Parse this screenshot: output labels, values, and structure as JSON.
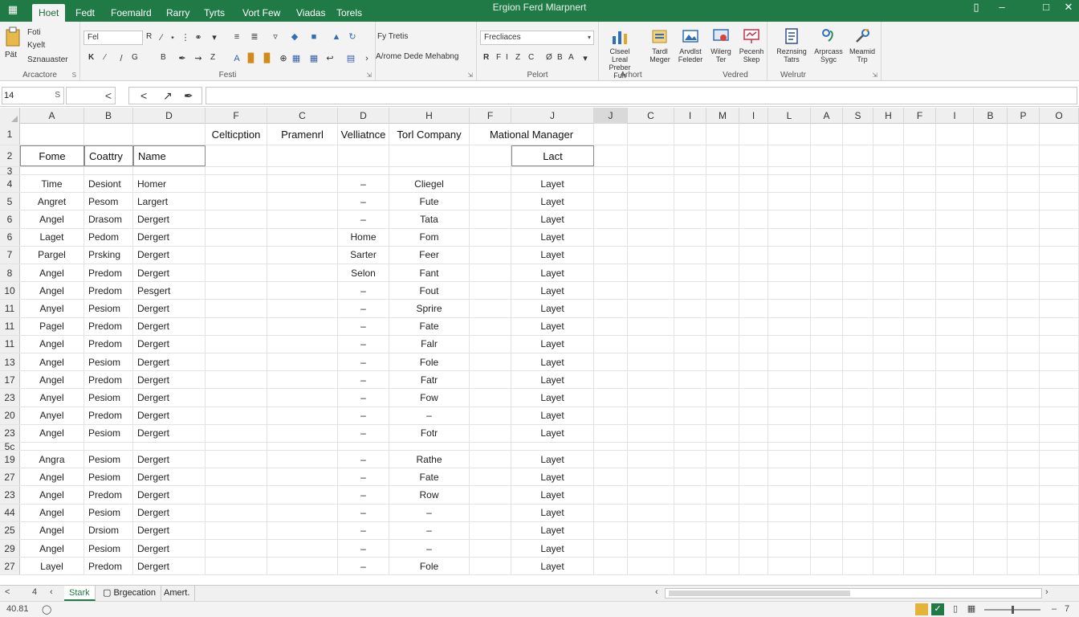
{
  "window": {
    "title": "Ergion Ferd Mlarpnert",
    "app_icon": "grid-icon",
    "tabs": [
      "Hoet",
      "Fedt",
      "Foemalrd",
      "Rarry",
      "Tyrts",
      "Vort Few",
      "Viadas",
      "Torels"
    ],
    "controls": [
      "▯",
      "–",
      "□",
      "✕"
    ]
  },
  "ribbon": {
    "clipboard": {
      "label": "Arcactore",
      "lines": [
        "Foti",
        "Kyelt",
        "Sznauaster"
      ],
      "paste_label": "Pät"
    },
    "font": {
      "label": "Festi",
      "font_name": "Fel",
      "size": "R",
      "row2": [
        "K",
        "⁄",
        "G",
        "B",
        "Z",
        "K"
      ]
    },
    "alignment": {
      "top_label": "Fy Tretis",
      "bottom_label": "A/rome Dede Mehabng"
    },
    "number": {
      "label": "Pelort",
      "format": "Frecliaces",
      "row2": [
        "R",
        "F",
        "I",
        "Z",
        "C",
        "Ø",
        "B",
        "A"
      ]
    },
    "styles": {
      "label": "Arhort",
      "buttons": [
        "Clseel Lreal\nPreber Fuh",
        "Tardl\nMeger",
        "Arvdlst\nFeleder",
        "Wilerg\nTer",
        "Pecenh\nSkep"
      ]
    },
    "editing": {
      "label": "Vedred",
      "buttons": [
        "Reznsing\nTatrs",
        "Arprcass\nSygc",
        "Meamid\nTrp"
      ]
    },
    "extra_label": "Welrutr"
  },
  "formula_bar": {
    "name_box": "14",
    "name_box_arrow": "S",
    "collapse": "<",
    "cancel": "<",
    "confirm": "↗",
    "fx": "✒",
    "value": ""
  },
  "grid": {
    "columns": [
      "A",
      "B",
      "D",
      "F",
      "C",
      "D",
      "H",
      "F",
      "J",
      "J",
      "C",
      "I",
      "M",
      "I",
      "L",
      "A",
      "S",
      "H",
      "F",
      "I",
      "B",
      "P",
      "O"
    ],
    "header_row": {
      "num": "1",
      "cells": [
        "",
        "",
        "",
        "Celticption",
        "Pramenrl",
        "Velliatnce",
        "Torl Company",
        "Mational Manager"
      ]
    },
    "label_row": {
      "num": "2",
      "cells": [
        "Fome",
        "Coattry",
        "Name",
        "",
        "",
        "",
        "",
        "",
        "Lact"
      ]
    },
    "blank_row": {
      "num": "3"
    },
    "rows": [
      {
        "num": "4",
        "a": "Time",
        "b": "Desiont",
        "c": "Homer",
        "f": "–",
        "h": "Cliegel",
        "j": "Layet"
      },
      {
        "num": "5",
        "a": "Angret",
        "b": "Pesom",
        "c": "Largert",
        "f": "–",
        "h": "Fute",
        "j": "Layet"
      },
      {
        "num": "6",
        "a": "Angel",
        "b": "Drasom",
        "c": "Dergert",
        "f": "–",
        "h": "Tata",
        "j": "Layet"
      },
      {
        "num": "6",
        "a": "Laget",
        "b": "Pedom",
        "c": "Dergert",
        "f": "Home",
        "h": "Fom",
        "j": "Layet"
      },
      {
        "num": "7",
        "a": "Pargel",
        "b": "Prsking",
        "c": "Dergert",
        "f": "Sarter",
        "h": "Feer",
        "j": "Layet"
      },
      {
        "num": "8",
        "a": "Angel",
        "b": "Predom",
        "c": "Dergert",
        "f": "Selon",
        "h": "Fant",
        "j": "Layet"
      },
      {
        "num": "10",
        "a": "Angel",
        "b": "Predom",
        "c": "Pesgert",
        "f": "–",
        "h": "Fout",
        "j": "Layet"
      },
      {
        "num": "11",
        "a": "Anyel",
        "b": "Pesiom",
        "c": "Dergert",
        "f": "–",
        "h": "Sprire",
        "j": "Layet"
      },
      {
        "num": "11",
        "a": "Pagel",
        "b": "Predom",
        "c": "Dergert",
        "f": "–",
        "h": "Fate",
        "j": "Layet"
      },
      {
        "num": "11",
        "a": "Angel",
        "b": "Predom",
        "c": "Dergert",
        "f": "–",
        "h": "Falr",
        "j": "Layet"
      },
      {
        "num": "13",
        "a": "Angel",
        "b": "Pesiom",
        "c": "Dergert",
        "f": "–",
        "h": "Fole",
        "j": "Layet"
      },
      {
        "num": "17",
        "a": "Angel",
        "b": "Predom",
        "c": "Dergert",
        "f": "–",
        "h": "Fatr",
        "j": "Layet"
      },
      {
        "num": "23",
        "a": "Anyel",
        "b": "Pesiom",
        "c": "Dergert",
        "f": "–",
        "h": "Fow",
        "j": "Layet"
      },
      {
        "num": "20",
        "a": "Anyel",
        "b": "Predom",
        "c": "Dergert",
        "f": "–",
        "h": "–",
        "j": "Layet"
      },
      {
        "num": "23",
        "a": "Angel",
        "b": "Pesiom",
        "c": "Dergert",
        "f": "–",
        "h": "Fotr",
        "j": "Layet"
      },
      {
        "num": "5c",
        "a": "",
        "b": "",
        "c": "",
        "f": "",
        "h": "",
        "j": ""
      },
      {
        "num": "19",
        "a": "Angra",
        "b": "Pesiom",
        "c": "Dergert",
        "f": "–",
        "h": "Rathe",
        "j": "Layet"
      },
      {
        "num": "27",
        "a": "Angel",
        "b": "Pesiom",
        "c": "Dergert",
        "f": "–",
        "h": "Fate",
        "j": "Layet"
      },
      {
        "num": "23",
        "a": "Angel",
        "b": "Predom",
        "c": "Dergert",
        "f": "–",
        "h": "Row",
        "j": "Layet"
      },
      {
        "num": "44",
        "a": "Angel",
        "b": "Pesiom",
        "c": "Dergert",
        "f": "–",
        "h": "–",
        "j": "Layet"
      },
      {
        "num": "25",
        "a": "Angel",
        "b": "Drsiom",
        "c": "Dergert",
        "f": "–",
        "h": "–",
        "j": "Layet"
      },
      {
        "num": "29",
        "a": "Angel",
        "b": "Pesiom",
        "c": "Dergert",
        "f": "–",
        "h": "–",
        "j": "Layet"
      },
      {
        "num": "27",
        "a": "Layel",
        "b": "Predom",
        "c": "Dergert",
        "f": "–",
        "h": "Fole",
        "j": "Layet"
      }
    ]
  },
  "sheets": {
    "nav": [
      "<",
      "4",
      "‹"
    ],
    "tabs": [
      "Stark",
      "▢ Brgecation",
      "Amert."
    ],
    "active": 0
  },
  "status": {
    "left": "40.81",
    "ready_icon": "circle-icon",
    "zoom": "7",
    "zoom_plus": "–"
  },
  "colors": {
    "title_green": "#1f7a45",
    "ribbon_bg": "#f3f3f3",
    "header_bg": "#efefef"
  }
}
